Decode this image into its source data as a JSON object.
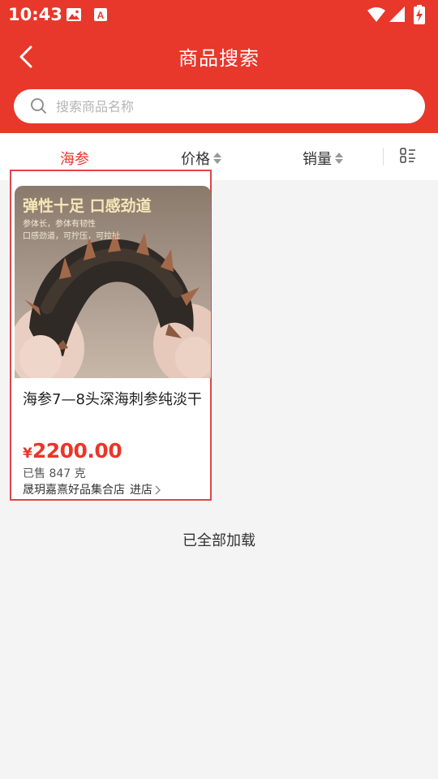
{
  "status_bar": {
    "time": "10:43"
  },
  "header": {
    "title": "商品搜索"
  },
  "search": {
    "placeholder": "搜索商品名称",
    "value": ""
  },
  "filters": [
    {
      "label": "海参",
      "active": true
    },
    {
      "label": "价格",
      "sortable": true
    },
    {
      "label": "销量",
      "sortable": true
    }
  ],
  "products": [
    {
      "image_headline": "弹性十足 口感劲道",
      "image_sub_line1": "参体长，参体有韧性",
      "image_sub_line2": "口感劲道，可拧压，可拉扯",
      "name": "海参7—8头深海刺参纯淡干",
      "price_symbol": "¥",
      "price": "2200.00",
      "sold": "已售 847 克",
      "store": "晟玥嘉熹好品集合店",
      "store_link": "进店"
    }
  ],
  "footer": {
    "end_text": "已全部加载"
  },
  "colors": {
    "brand_red": "#e8372b",
    "card_border": "#e0454a"
  },
  "icons": [
    "back-arrow-icon",
    "search-icon",
    "layout-toggle-icon",
    "chevron-right-icon",
    "wifi-icon",
    "signal-icon",
    "battery-icon",
    "image-icon",
    "font-icon"
  ]
}
